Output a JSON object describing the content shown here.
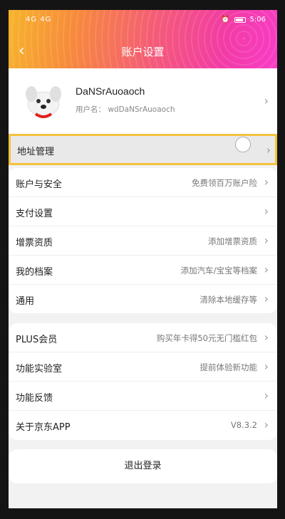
{
  "status_bar": {
    "left": "4G 4G",
    "time": "5:06"
  },
  "header": {
    "back_icon": "chevron-left-icon",
    "title": "账户设置"
  },
  "profile": {
    "username": "DaNSrAuoaoch",
    "user_id": "用户名： wdDaNSrAuoaoch"
  },
  "address": {
    "label": "地址管理"
  },
  "group1": [
    {
      "label": "账户与安全",
      "value": "免费领百万账户险"
    },
    {
      "label": "支付设置",
      "value": ""
    },
    {
      "label": "增票资质",
      "value": "添加增票资质"
    },
    {
      "label": "我的档案",
      "value": "添加汽车/宝宝等档案"
    },
    {
      "label": "通用",
      "value": "清除本地缓存等"
    }
  ],
  "group2": [
    {
      "label": "PLUS会员",
      "value": "购买年卡得50元无门槛红包"
    },
    {
      "label": "功能实验室",
      "value": "提前体验新功能"
    },
    {
      "label": "功能反馈",
      "value": ""
    },
    {
      "label": "关于京东APP",
      "value": "V8.3.2"
    }
  ],
  "logout": {
    "label": "退出登录"
  },
  "colors": {
    "header_start": "#f7b42c",
    "header_end": "#f83dc6",
    "highlight_border": "#f5c23b"
  }
}
